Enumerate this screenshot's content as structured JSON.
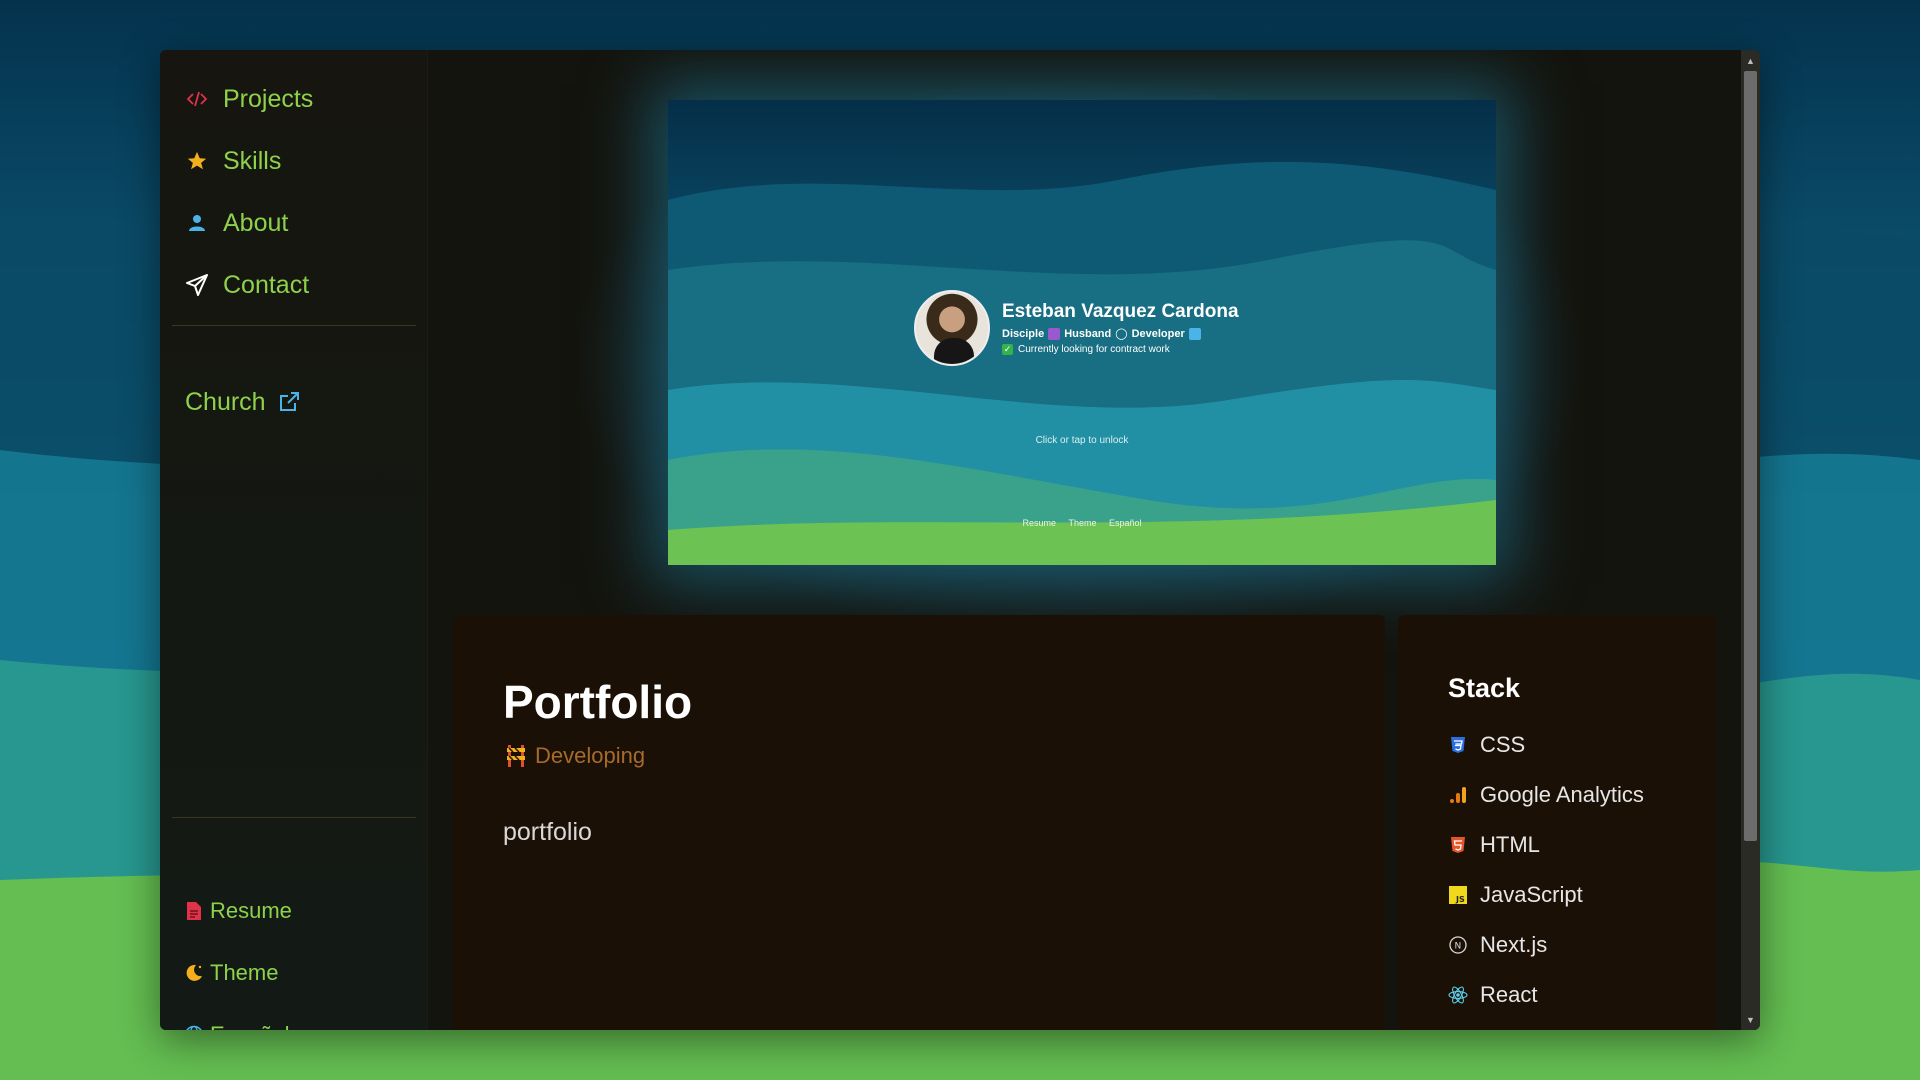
{
  "sidebar": {
    "nav": [
      {
        "label": "Projects",
        "icon": "code-icon"
      },
      {
        "label": "Skills",
        "icon": "star-icon"
      },
      {
        "label": "About",
        "icon": "user-icon"
      },
      {
        "label": "Contact",
        "icon": "send-icon"
      }
    ],
    "church": {
      "label": "Church",
      "icon": "external-link-icon"
    },
    "bottom": [
      {
        "label": "Resume",
        "icon": "document-icon"
      },
      {
        "label": "Theme",
        "icon": "moon-icon"
      },
      {
        "label": "Español",
        "icon": "globe-icon"
      }
    ],
    "accent": "#8ed14a"
  },
  "preview": {
    "name": "Esteban Vazquez Cardona",
    "tags": [
      "Disciple",
      "Husband",
      "Developer"
    ],
    "status": "Currently looking for contract work",
    "unlock_hint": "Click or tap to unlock",
    "links": [
      "Resume",
      "Theme",
      "Español"
    ]
  },
  "project": {
    "title": "Portfolio",
    "status": "Developing",
    "status_icon": "construction-icon",
    "description": "portfolio"
  },
  "stack": {
    "title": "Stack",
    "items": [
      {
        "label": "CSS",
        "icon": "css-icon"
      },
      {
        "label": "Google Analytics",
        "icon": "google-analytics-icon"
      },
      {
        "label": "HTML",
        "icon": "html-icon"
      },
      {
        "label": "JavaScript",
        "icon": "javascript-icon"
      },
      {
        "label": "Next.js",
        "icon": "nextjs-icon"
      },
      {
        "label": "React",
        "icon": "react-icon"
      }
    ]
  }
}
